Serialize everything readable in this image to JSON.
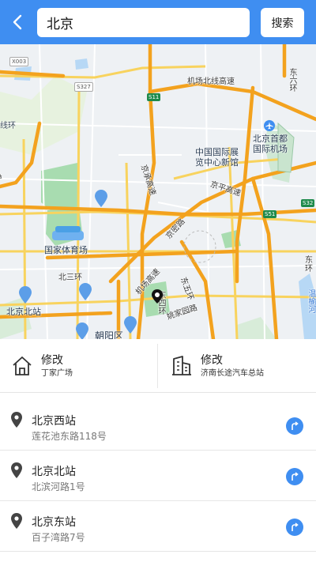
{
  "search": {
    "query": "北京",
    "button": "搜索"
  },
  "map": {
    "labels": {
      "x003": "X003",
      "s327": "S327",
      "s11": "S11",
      "airport_north": "机场北线高速",
      "east5": "东六环",
      "line_west": "线环",
      "capital_airport": "北京首都\n国际机场",
      "expo": "中国国际展\n览中心新馆",
      "jingcheng": "京承高速",
      "jingping": "京平高速",
      "s51": "S51",
      "s32": "S32",
      "highway_w": "高速",
      "stadium": "国家体育场",
      "north3": "北三环",
      "airport_hwy": "机场高速",
      "jingmi": "京密路",
      "east5ring": "东五环",
      "east4": "东四环",
      "yaojia": "姚家园路",
      "bj_north_station": "北京北站",
      "chaoyang": "朝阳区",
      "east_right": "东\n环",
      "wenyu": "温榆河"
    }
  },
  "quick": {
    "home": {
      "title": "修改",
      "subtitle": "丁家广场"
    },
    "company": {
      "title": "修改",
      "subtitle": "济南长途汽车总站"
    }
  },
  "results": [
    {
      "name": "北京西站",
      "address": "莲花池东路118号"
    },
    {
      "name": "北京北站",
      "address": "北滨河路1号"
    },
    {
      "name": "北京东站",
      "address": "百子湾路7号"
    }
  ],
  "colors": {
    "primary": "#3f8ef1",
    "highway": "#f3a21e",
    "road": "#f8d35e",
    "green": "#a8dcb0"
  }
}
